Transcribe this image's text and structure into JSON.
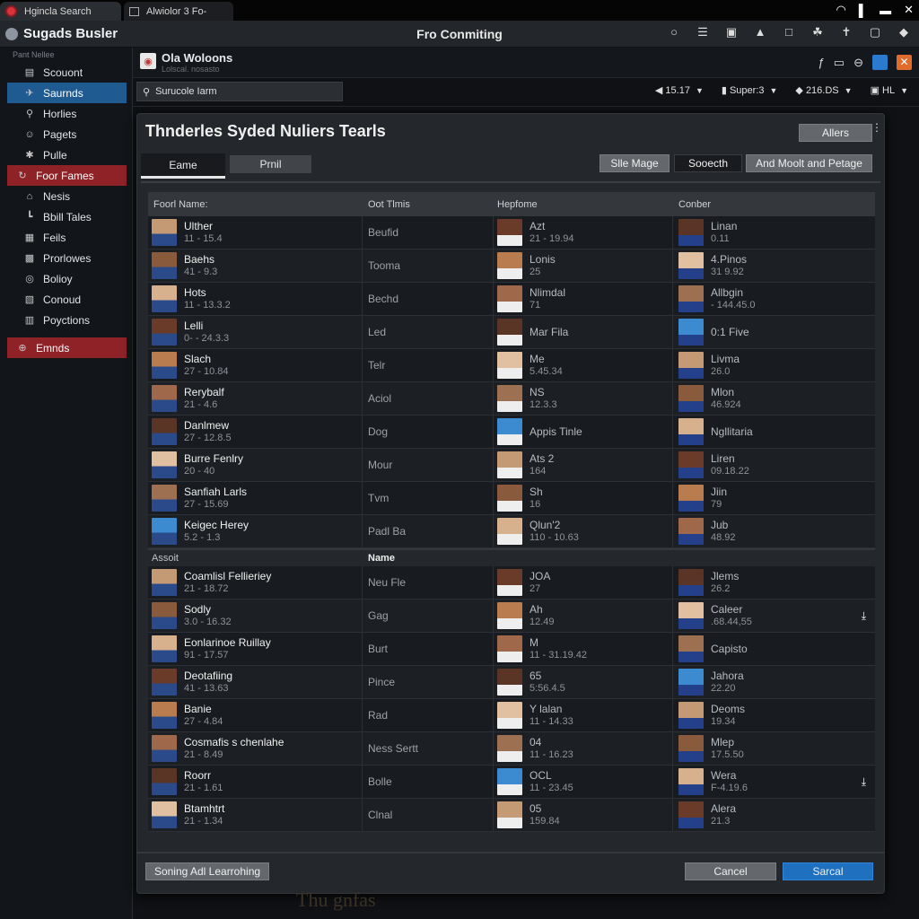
{
  "browser": {
    "tabs": [
      {
        "label": "Hgincla Search",
        "icon": "record-icon"
      },
      {
        "label": "Alwiolor 3 Fo-",
        "icon": "window-icon"
      }
    ],
    "system_icons": [
      "wifi-icon",
      "signal-icon",
      "battery-icon",
      "close-icon"
    ]
  },
  "app": {
    "title": "Sugads Busler",
    "center_title": "Fro Conmiting",
    "toolbar_icons": [
      "circle-icon",
      "menu-icon",
      "screen-icon",
      "bell-icon",
      "image-icon",
      "gamepad-icon",
      "pin-icon",
      "chart-icon",
      "shield-icon"
    ]
  },
  "sidebar": {
    "header": "Pant Nellee",
    "items": [
      {
        "label": "Scouont",
        "icon": "folder-icon",
        "state": "normal"
      },
      {
        "label": "Saurnds",
        "icon": "bird-icon",
        "state": "active"
      },
      {
        "label": "Horlies",
        "icon": "search-icon",
        "state": "normal"
      },
      {
        "label": "Pagets",
        "icon": "user-icon",
        "state": "normal"
      },
      {
        "label": "Pulle",
        "icon": "gear-icon",
        "state": "normal"
      },
      {
        "label": "Foor Fames",
        "icon": "refresh-icon",
        "state": "section"
      },
      {
        "label": "Nesis",
        "icon": "home-icon",
        "state": "normal"
      },
      {
        "label": "Bbill Tales",
        "icon": "stairs-icon",
        "state": "normal"
      },
      {
        "label": "Feils",
        "icon": "save-icon",
        "state": "normal"
      },
      {
        "label": "Prorlowes",
        "icon": "bag-icon",
        "state": "normal"
      },
      {
        "label": "Bolioy",
        "icon": "globe-icon",
        "state": "normal"
      },
      {
        "label": "Conoud",
        "icon": "clipboard-icon",
        "state": "normal"
      },
      {
        "label": "Poyctions",
        "icon": "calendar-icon",
        "state": "normal"
      }
    ],
    "bottom_item": {
      "label": "Emnds",
      "icon": "plus-circle-icon"
    }
  },
  "profile": {
    "name": "Ola Woloons",
    "subtitle": "Lolscal. nosasto",
    "icons": [
      "font-icon",
      "rect-icon",
      "minus-circle-icon",
      "blue-app-icon",
      "orange-close-icon"
    ]
  },
  "filter_bar": {
    "search_value": "Surucole Iarm",
    "filters": [
      {
        "icon": "volume-icon",
        "value": "15.17"
      },
      {
        "icon": "thumb-icon",
        "value": "Super:3"
      },
      {
        "icon": "diamond-icon",
        "value": "216.DS"
      },
      {
        "icon": "lock-icon",
        "value": "HL"
      }
    ]
  },
  "dialog": {
    "title": "Thnderles Syded Nuliers Tearls",
    "alters_button": "Allers",
    "tabs": [
      {
        "label": "Eame",
        "active": true
      },
      {
        "label": "Prnil",
        "active": false
      }
    ],
    "actions": [
      "Slle Mage",
      "Sooecth",
      "And Moolt and Petage"
    ],
    "columns": [
      "Foorl Name:",
      "Oot Tlmis",
      "Hepfome",
      "Conber"
    ],
    "section1": [
      {
        "name": "Ulther",
        "stat": "11 - 15.4",
        "team": "Beufid",
        "p2": "Azt",
        "p2s": "21 - 19.94",
        "p3": "Linan",
        "p3s": "0.11"
      },
      {
        "name": "Baehs",
        "stat": "41 - 9.3",
        "team": "Tooma",
        "p2": "Lonis",
        "p2s": "25",
        "p3": "4.Pinos",
        "p3s": "31 9.92"
      },
      {
        "name": "Hots",
        "stat": "11 - 13.3.2",
        "team": "Bechd",
        "p2": "Nlimdal",
        "p2s": "71",
        "p3": "Allbgin",
        "p3s": "- 144.45.0"
      },
      {
        "name": "Lelli",
        "stat": "0- - 24.3.3",
        "team": "Led",
        "p2": "Mar Fila",
        "p2s": "",
        "p3": "0:1 Five",
        "p3s": ""
      },
      {
        "name": "Slach",
        "stat": "27 - 10.84",
        "team": "Telr",
        "p2": "Me",
        "p2s": "5.45.34",
        "p3": "Livma",
        "p3s": "26.0"
      },
      {
        "name": "Rerybalf",
        "stat": "21 - 4.6",
        "team": "Aciol",
        "p2": "NS",
        "p2s": "12.3.3",
        "p3": "Mlon",
        "p3s": "46.924"
      },
      {
        "name": "Danlmew",
        "stat": "27 - 12.8.5",
        "team": "Dog",
        "p2": "Appis Tinle",
        "p2s": "",
        "p3": "Ngllitaria",
        "p3s": ""
      },
      {
        "name": "Burre Fenlry",
        "stat": "20 - 40",
        "team": "Mour",
        "p2": "Ats 2",
        "p2s": "164",
        "p3": "Liren",
        "p3s": "09.18.22"
      },
      {
        "name": "Sanfiah Larls",
        "stat": "27 - 15.69",
        "team": "Tvm",
        "p2": "Sh",
        "p2s": "16",
        "p3": "Jiin",
        "p3s": "79"
      },
      {
        "name": "Keigec Herey",
        "stat": "5.2 - 1.3",
        "team": "Padl Ba",
        "p2": "Qlun'2",
        "p2s": "110 - 10.63",
        "p3": "Jub",
        "p3s": "48.92"
      }
    ],
    "section2_headers": [
      "Assoit",
      "Name"
    ],
    "section2": [
      {
        "name": "Coamlisl Fellieriey",
        "stat": "21 - 18.72",
        "team": "Neu Fle",
        "p2": "JOA",
        "p2s": "27",
        "p3": "Jlems",
        "p3s": "26.2",
        "download": false
      },
      {
        "name": "Sodly",
        "stat": "3.0 - 16.32",
        "team": "Gag",
        "p2": "Ah",
        "p2s": "12.49",
        "p3": "Caleer",
        "p3s": ".68.44,55",
        "download": true
      },
      {
        "name": "Eonlarinoe Ruillay",
        "stat": "91 - 17.57",
        "team": "Burt",
        "p2": "M",
        "p2s": "11 - 31.19.42",
        "p3": "Capisto",
        "p3s": "",
        "download": false
      },
      {
        "name": "Deotafiing",
        "stat": "41 - 13.63",
        "team": "Pince",
        "p2": "65",
        "p2s": "5:56.4.5",
        "p3": "Jahora",
        "p3s": "22.20",
        "download": false
      },
      {
        "name": "Banie",
        "stat": "27 - 4.84",
        "team": "Rad",
        "p2": "Y lalan",
        "p2s": "11 - 14.33",
        "p3": "Deoms",
        "p3s": "19.34",
        "download": false
      },
      {
        "name": "Cosmafis s chenlahe",
        "stat": "21 - 8.49",
        "team": "Ness Sertt",
        "p2": "04",
        "p2s": "11 - 16.23",
        "p3": "Mlep",
        "p3s": "17.5.50",
        "download": false
      },
      {
        "name": "Roorr",
        "stat": "21 - 1.61",
        "team": "Bolle",
        "p2": "OCL",
        "p2s": "11 - 23.45",
        "p3": "Wera",
        "p3s": "F-4.19.6",
        "download": true
      },
      {
        "name": "Btamhtrt",
        "stat": "21 - 1.34",
        "team": "Clnal",
        "p2": "05",
        "p2s": "159.84",
        "p3": "Alera",
        "p3s": "21.3",
        "download": false
      }
    ],
    "footer_left_button": "Soning Adl Learrohing",
    "cancel_button": "Cancel",
    "confirm_button": "Sarcal"
  },
  "background_text": "Thu gnfas"
}
